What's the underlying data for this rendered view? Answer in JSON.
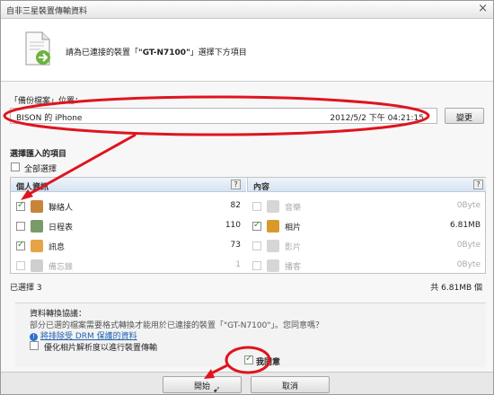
{
  "window": {
    "title": "自非三星裝置傳輸資料"
  },
  "header": {
    "prefix": "請為已連接的裝置「",
    "device": "\"GT-N7100\"",
    "suffix": "」選擇下方項目"
  },
  "backup": {
    "label": "「備份檔案」位置：",
    "device": "BISON 的 iPhone",
    "datetime": "2012/5/2 下午 04:21:15",
    "change_button": "變更"
  },
  "select": {
    "title": "選擇匯入的項目",
    "select_all": "全部選擇"
  },
  "personal": {
    "header": "個人資訊",
    "help": "?",
    "items": [
      {
        "label": "聯絡人",
        "value": "82",
        "checked": true,
        "enabled": true,
        "icon": "contacts-icon",
        "color": "#c8853a"
      },
      {
        "label": "日程表",
        "value": "110",
        "checked": false,
        "enabled": true,
        "icon": "calendar-icon",
        "color": "#7a9a6a"
      },
      {
        "label": "訊息",
        "value": "73",
        "checked": true,
        "enabled": true,
        "icon": "message-icon",
        "color": "#e7a34a"
      },
      {
        "label": "備忘錄",
        "value": "1",
        "checked": false,
        "enabled": false,
        "icon": "memo-icon",
        "color": "#cfcfcf"
      }
    ]
  },
  "content": {
    "header": "內容",
    "help": "?",
    "items": [
      {
        "label": "音樂",
        "value": "0Byte",
        "checked": false,
        "enabled": false,
        "icon": "music-icon",
        "color": "#d6d6d6"
      },
      {
        "label": "相片",
        "value": "6.81MB",
        "checked": true,
        "enabled": true,
        "icon": "photo-icon",
        "color": "#d99a2b"
      },
      {
        "label": "影片",
        "value": "0Byte",
        "checked": false,
        "enabled": false,
        "icon": "video-icon",
        "color": "#d6d6d6"
      },
      {
        "label": "播客",
        "value": "0Byte",
        "checked": false,
        "enabled": false,
        "icon": "podcast-icon",
        "color": "#d6d6d6"
      }
    ]
  },
  "summary": {
    "selected": "已選擇 3",
    "total": "共 6.81MB 個"
  },
  "agreement": {
    "title": "資料轉換協議：",
    "desc": "部分已選的檔案需要格式轉換才能用於已連接的裝置「\"GT-N7100\"」。您同意嗎？",
    "drm_link": "將排除受 DRM 保護的資料",
    "optimize": "優化相片解析度以進行裝置傳輸",
    "agree": "我同意"
  },
  "footer": {
    "start": "開始",
    "cancel": "取消"
  },
  "colors": {
    "annotation": "#e0141e",
    "check": "#3b9a2e",
    "panel_header": "#d6e3f1"
  }
}
